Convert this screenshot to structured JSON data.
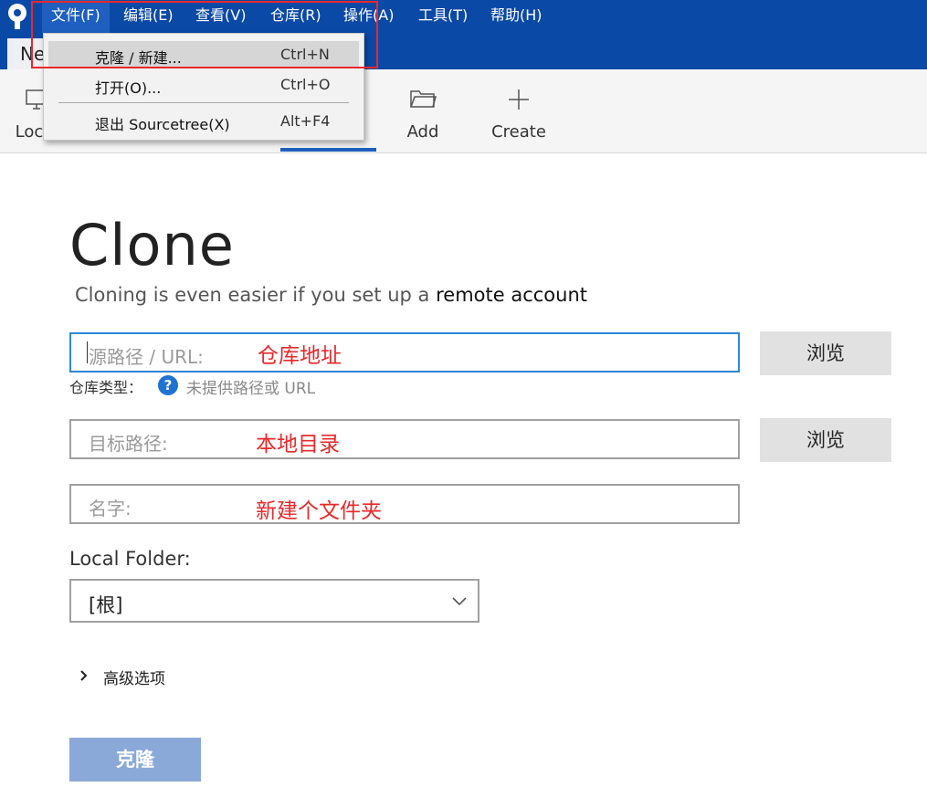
{
  "menubar": {
    "items": [
      "文件(F)",
      "编辑(E)",
      "查看(V)",
      "仓库(R)",
      "操作(A)",
      "工具(T)",
      "帮助(H)"
    ]
  },
  "tab": {
    "label": "New tab"
  },
  "toolbar": {
    "tools": [
      {
        "label": "Local",
        "icon": "monitor-icon"
      },
      {
        "label": "Add",
        "icon": "folder-icon"
      },
      {
        "label": "Create",
        "icon": "plus-icon"
      }
    ]
  },
  "file_menu": {
    "items": [
      {
        "label": "克隆 / 新建...",
        "shortcut": "Ctrl+N",
        "highlighted": true
      },
      {
        "label": "打开(O)...",
        "shortcut": "Ctrl+O"
      },
      {
        "label": "退出 Sourcetree(X)",
        "shortcut": "Alt+F4"
      }
    ]
  },
  "clone_form": {
    "title": "Clone",
    "subtitle_prefix": "Cloning is even easier if you set up a",
    "subtitle_link": "remote account",
    "source": {
      "placeholder": "源路径 / URL:",
      "annotation": "仓库地址"
    },
    "browse_label": "浏览",
    "repo_type_label": "仓库类型：",
    "repo_type_value": "未提供路径或 URL",
    "destination": {
      "placeholder": "目标路径:",
      "annotation": "本地目录"
    },
    "name": {
      "placeholder": "名字:",
      "annotation": "新建个文件夹"
    },
    "local_folder_label": "Local Folder:",
    "local_folder_value": "[根]",
    "advanced_label": "高级选项",
    "clone_button": "克隆"
  },
  "colors": {
    "menubar": "#0b49a7",
    "annotation_red": "#e8292b",
    "focus_blue": "#2f86d8",
    "clone_button": "#8aa9d8"
  }
}
